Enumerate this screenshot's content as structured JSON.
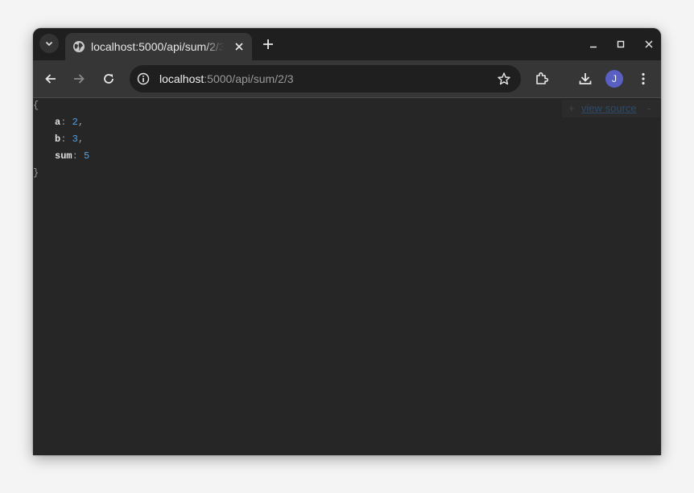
{
  "browser": {
    "tab": {
      "title": "localhost:5000/api/sum/2/3"
    },
    "address_bar": {
      "host": "localhost",
      "path": ":5000/api/sum/2/3"
    },
    "profile_initial": "J"
  },
  "json_view": {
    "open_brace": "{",
    "close_brace": "}",
    "entries": [
      {
        "key": "a",
        "value": "2",
        "comma": ","
      },
      {
        "key": "b",
        "value": "3",
        "comma": ","
      },
      {
        "key": "sum",
        "value": "5",
        "comma": ""
      }
    ],
    "view_source": {
      "plus": "+",
      "label": "view source",
      "minus": "-"
    }
  },
  "colors": {
    "background": "#262626",
    "number": "#4aa3f0",
    "avatar": "#5a5fc4"
  }
}
